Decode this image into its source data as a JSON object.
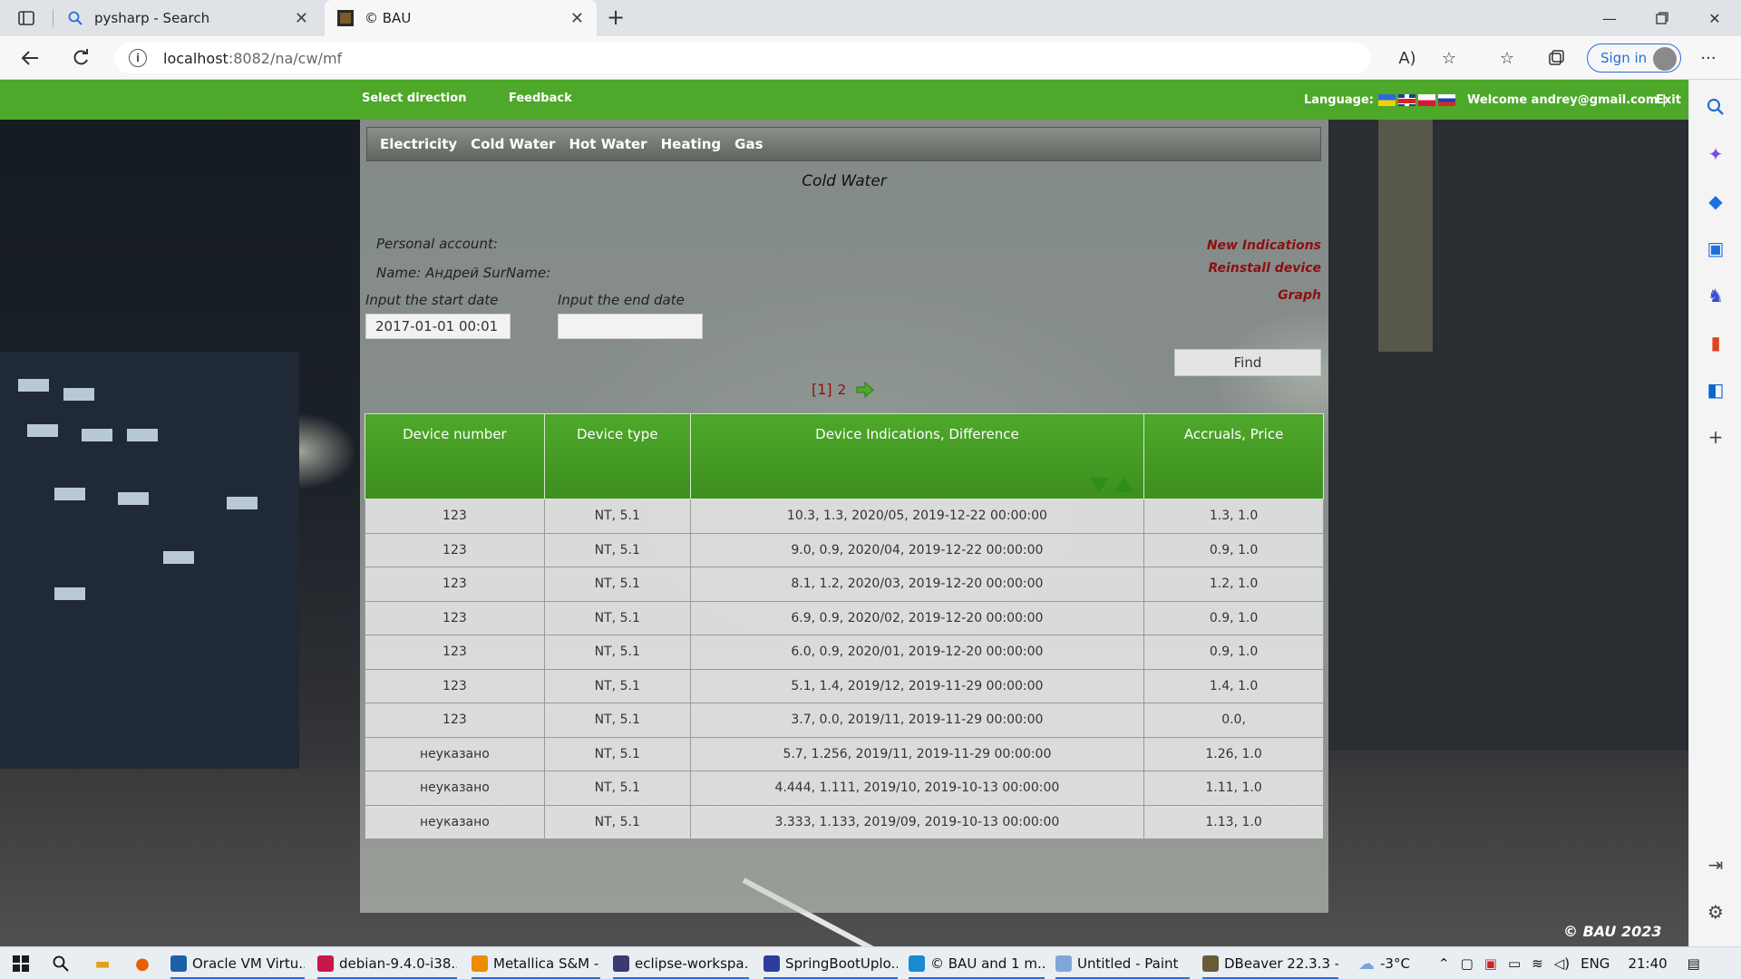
{
  "browser": {
    "tabs": [
      {
        "title": "pysharp - Search",
        "icon": "search-icon"
      },
      {
        "title": "© BAU",
        "icon": "site-favicon"
      }
    ],
    "url_host": "localhost",
    "url_path": ":8082/na/cw/mf",
    "signin_label": "Sign in"
  },
  "site": {
    "nav": {
      "select_direction": "Select direction",
      "feedback": "Feedback"
    },
    "language_label": "Language:",
    "languages": [
      "Ukrainian",
      "English",
      "Polish",
      "Russian"
    ],
    "welcome": "Welcome andrey@gmail.com |",
    "exit": "Exit",
    "tabs": [
      "Electricity",
      "Cold Water",
      "Hot Water",
      "Heating",
      "Gas"
    ],
    "page_title": "Cold Water",
    "personal_account_label": "Personal account:",
    "name_label": "Name: Андрей SurName:",
    "start_date_label": "Input the start date",
    "end_date_label": "Input the end date",
    "start_date_value": "2017-01-01 00:01",
    "end_date_value": "",
    "links": {
      "new_indications": "New Indications",
      "reinstall": "Reinstall device",
      "graph": "Graph"
    },
    "find_label": "Find",
    "pager": {
      "current": "[1]",
      "next_page": "2"
    },
    "table": {
      "headers": [
        "Device number",
        "Device type",
        "Device Indications, Difference",
        "Accruals, Price"
      ],
      "rows": [
        [
          "123",
          "NT, 5.1",
          "10.3, 1.3, 2020/05, 2019-12-22 00:00:00",
          "1.3, 1.0"
        ],
        [
          "123",
          "NT, 5.1",
          "9.0, 0.9, 2020/04, 2019-12-22 00:00:00",
          "0.9, 1.0"
        ],
        [
          "123",
          "NT, 5.1",
          "8.1, 1.2, 2020/03, 2019-12-20 00:00:00",
          "1.2, 1.0"
        ],
        [
          "123",
          "NT, 5.1",
          "6.9, 0.9, 2020/02, 2019-12-20 00:00:00",
          "0.9, 1.0"
        ],
        [
          "123",
          "NT, 5.1",
          "6.0, 0.9, 2020/01, 2019-12-20 00:00:00",
          "0.9, 1.0"
        ],
        [
          "123",
          "NT, 5.1",
          "5.1, 1.4, 2019/12, 2019-11-29 00:00:00",
          "1.4, 1.0"
        ],
        [
          "123",
          "NT, 5.1",
          "3.7, 0.0, 2019/11, 2019-11-29 00:00:00",
          "0.0,"
        ],
        [
          "неуказано",
          "NT, 5.1",
          "5.7, 1.256, 2019/11, 2019-11-29 00:00:00",
          "1.26, 1.0"
        ],
        [
          "неуказано",
          "NT, 5.1",
          "4.444, 1.111, 2019/10, 2019-10-13 00:00:00",
          "1.11, 1.0"
        ],
        [
          "неуказано",
          "NT, 5.1",
          "3.333, 1.133, 2019/09, 2019-10-13 00:00:00",
          "1.13, 1.0"
        ]
      ]
    },
    "copyright": "© BAU 2023"
  },
  "taskbar": {
    "apps": [
      {
        "label": "Oracle VM Virtu...",
        "color": "#1f5fa8"
      },
      {
        "label": "debian-9.4.0-i38...",
        "color": "#c8174b"
      },
      {
        "label": "Metallica S&M -...",
        "color": "#f08a00"
      },
      {
        "label": "eclipse-workspa...",
        "color": "#3b3a72"
      },
      {
        "label": "SpringBootUplo...",
        "color": "#2c3e9a"
      },
      {
        "label": "© BAU and 1 m...",
        "color": "#1a8ad4"
      },
      {
        "label": "Untitled - Paint",
        "color": "#7ea7d8"
      },
      {
        "label": "DBeaver 22.3.3 -...",
        "color": "#6b5a3a"
      }
    ],
    "temperature": "-3°C",
    "language": "ENG",
    "time": "21:40"
  },
  "colors": {
    "site_green": "#4ea82a",
    "link_red": "#8b1010",
    "edge_blue": "#2b6dd6"
  }
}
